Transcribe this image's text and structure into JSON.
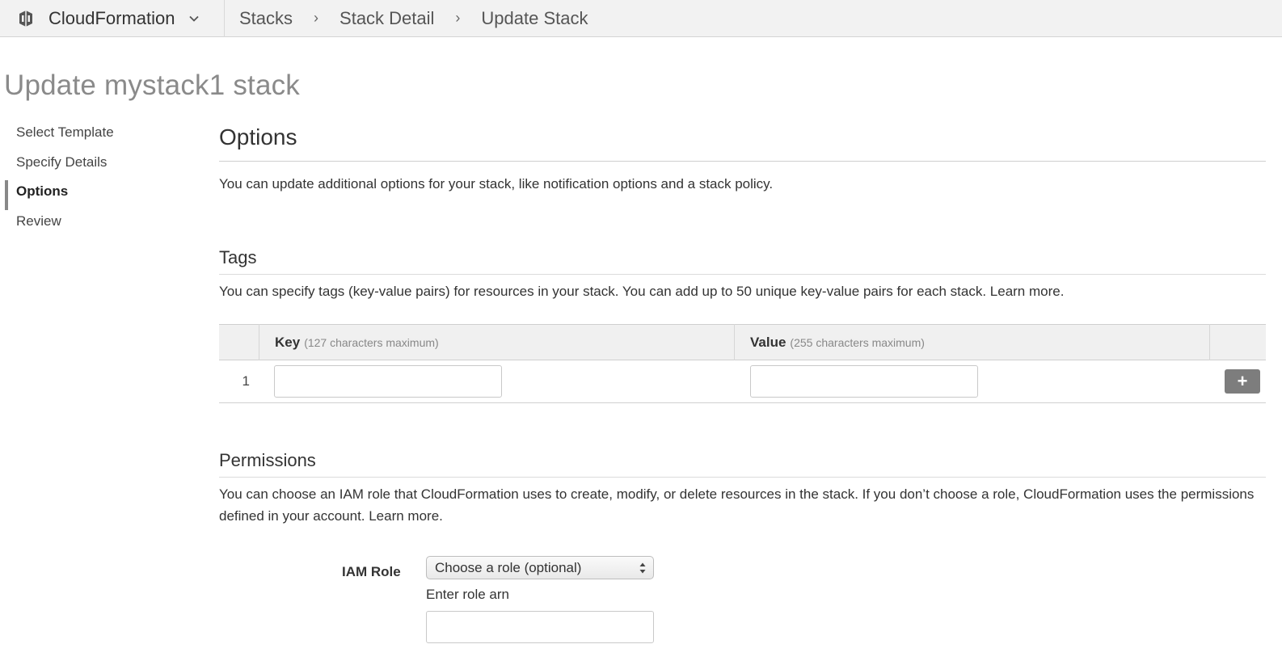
{
  "topbar": {
    "service_name": "CloudFormation",
    "service_icon": "cloudformation-logo-icon",
    "breadcrumbs": [
      "Stacks",
      "Stack Detail",
      "Update Stack"
    ],
    "separator": "›"
  },
  "page": {
    "title": "Update mystack1 stack"
  },
  "wizard": {
    "steps": [
      {
        "label": "Select Template",
        "active": false
      },
      {
        "label": "Specify Details",
        "active": false
      },
      {
        "label": "Options",
        "active": true
      },
      {
        "label": "Review",
        "active": false
      }
    ]
  },
  "options": {
    "heading": "Options",
    "description": "You can update additional options for your stack, like notification options and a stack policy."
  },
  "tags": {
    "heading": "Tags",
    "description": "You can specify tags (key-value pairs) for resources in your stack. You can add up to 50 unique key-value pairs for each stack. Learn more.",
    "columns": {
      "key_label": "Key",
      "key_hint": "(127 characters maximum)",
      "value_label": "Value",
      "value_hint": "(255 characters maximum)"
    },
    "rows": [
      {
        "index": "1",
        "key": "",
        "value": ""
      }
    ],
    "add_button": "+"
  },
  "permissions": {
    "heading": "Permissions",
    "description": "You can choose an IAM role that CloudFormation uses to create, modify, or delete resources in the stack. If you don’t choose a role, CloudFormation uses the permissions defined in your account. Learn more.",
    "role_label": "IAM Role",
    "role_select_value": "Choose a role (optional)",
    "arn_label": "Enter role arn",
    "arn_value": ""
  },
  "colors": {
    "topbar_bg": "#f2f2f2",
    "title_gray": "#8a8a8a",
    "add_button_bg": "#7d7d7d"
  }
}
